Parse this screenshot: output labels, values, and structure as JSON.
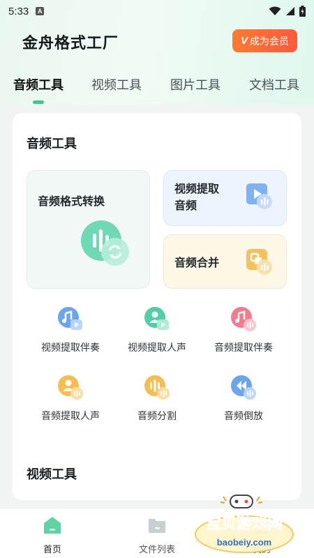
{
  "status_bar": {
    "time": "5:33",
    "notif_letter": "A"
  },
  "header": {
    "app_title": "金舟格式工厂",
    "vip_label": "成为会员",
    "vip_mark": "V"
  },
  "tabs": [
    {
      "label": "音频工具",
      "active": true
    },
    {
      "label": "视频工具",
      "active": false
    },
    {
      "label": "图片工具",
      "active": false
    },
    {
      "label": "文档工具",
      "active": false
    }
  ],
  "audio_section": {
    "title": "音频工具",
    "big_tile": "音频格式转换",
    "tile_video_extract_line1": "视频提取",
    "tile_video_extract_line2": "音频",
    "tile_merge": "音频合并",
    "grid": [
      {
        "label": "视频提取伴奏",
        "icon": "video-accompaniment-icon",
        "color": "#5a9bf0"
      },
      {
        "label": "视频提取人声",
        "icon": "video-vocal-icon",
        "color": "#3fcaa0"
      },
      {
        "label": "音频提取伴奏",
        "icon": "audio-accompaniment-icon",
        "color": "#f36b7f"
      },
      {
        "label": "音频提取人声",
        "icon": "audio-vocal-icon",
        "color": "#f5b941"
      },
      {
        "label": "音频分割",
        "icon": "audio-split-icon",
        "color": "#f5b941"
      },
      {
        "label": "音频倒放",
        "icon": "audio-reverse-icon",
        "color": "#5a9bf0"
      }
    ]
  },
  "video_section": {
    "title": "视频工具"
  },
  "bottom_nav": [
    {
      "label": "首页",
      "active": true
    },
    {
      "label": "文件列表",
      "active": false
    },
    {
      "label": "我的",
      "active": false
    }
  ],
  "watermark": {
    "text": "宝贝游戏网",
    "url": "baobeiy.com"
  },
  "colors": {
    "accent": "#38c98d",
    "vip": "#ff6a35"
  }
}
